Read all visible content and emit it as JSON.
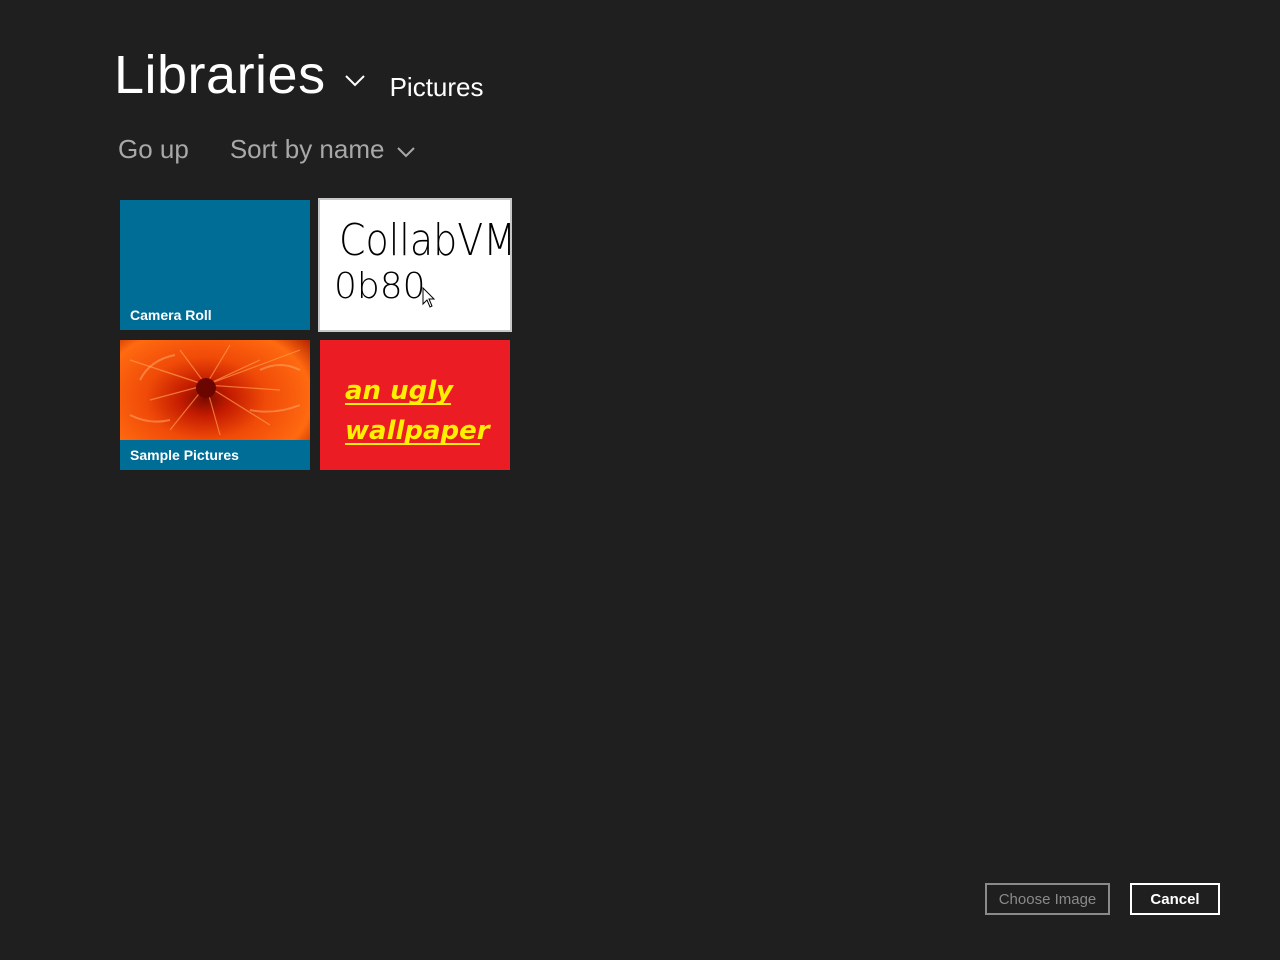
{
  "header": {
    "title": "Libraries",
    "subtitle": "Pictures"
  },
  "toolbar": {
    "go_up": "Go up",
    "sort": "Sort by name"
  },
  "tiles": [
    {
      "label": "Camera Roll",
      "color": "#006d96"
    },
    {
      "label": "",
      "image_text_line1": "CollabVM",
      "image_text_line2": "0b80"
    },
    {
      "label": "Sample Pictures",
      "color": "#006d96"
    },
    {
      "label": "",
      "image_text_line1": "an ugly",
      "image_text_line2": "wallpaper",
      "color": "#ec1c24",
      "text_color": "#ffef00"
    }
  ],
  "footer": {
    "choose_label": "Choose Image",
    "cancel_label": "Cancel"
  }
}
